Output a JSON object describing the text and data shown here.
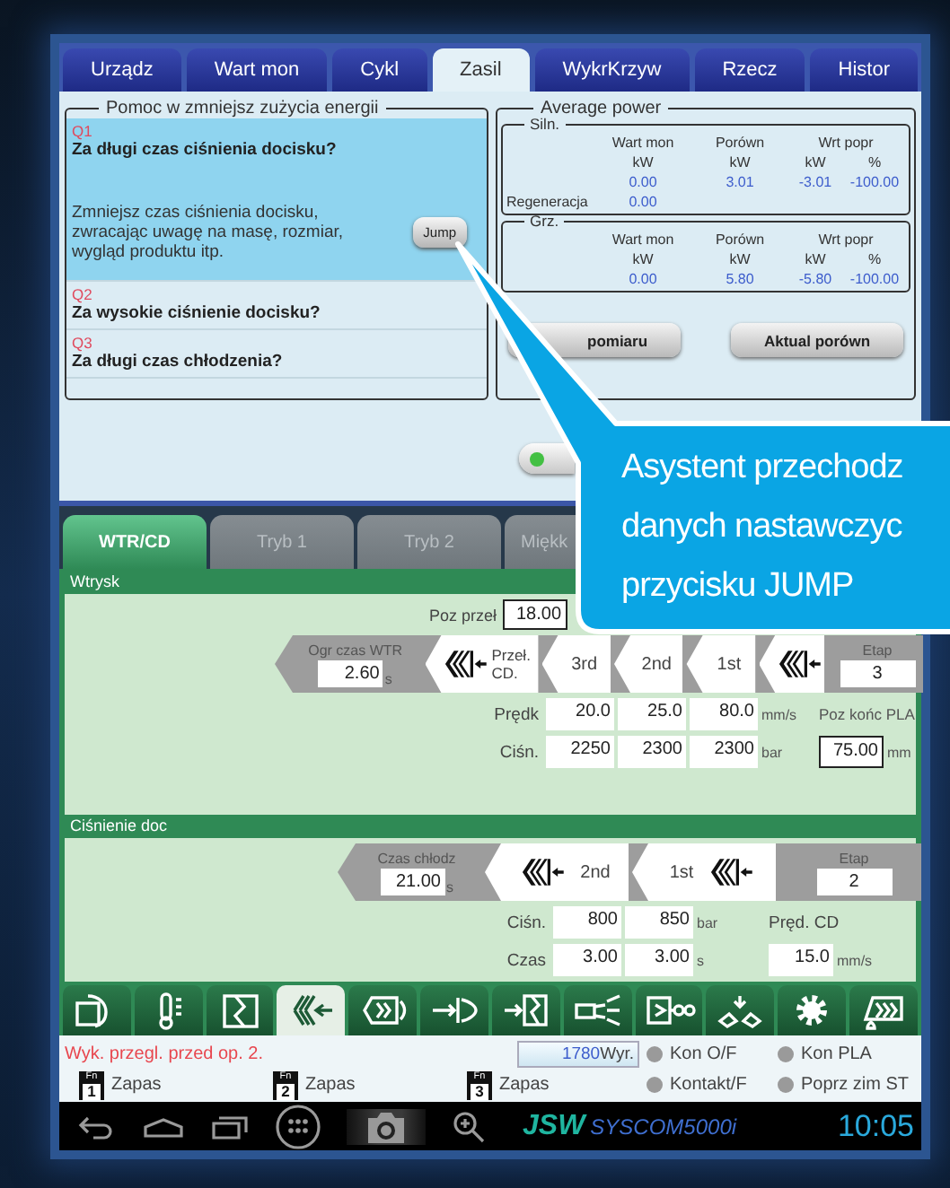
{
  "tabs": [
    {
      "label": "Urządz",
      "selected": false
    },
    {
      "label": "Wart mon",
      "selected": false
    },
    {
      "label": "Cykl",
      "selected": false
    },
    {
      "label": "Zasil",
      "selected": true
    },
    {
      "label": "WykrKrzyw",
      "selected": false
    },
    {
      "label": "Rzecz",
      "selected": false
    },
    {
      "label": "Histor",
      "selected": false
    }
  ],
  "help_panel": {
    "title": "Pomoc w zmniejsz zużycia energii",
    "items": [
      {
        "code": "Q1",
        "question": "Za długi czas ciśnienia docisku?",
        "selected": true,
        "answer": "Zmniejsz czas ciśnienia docisku, zwracając uwagę na masę, rozmiar, wygląd produktu itp.",
        "button": "Jump"
      },
      {
        "code": "Q2",
        "question": "Za wysokie ciśnienie docisku?",
        "selected": false
      },
      {
        "code": "Q3",
        "question": "Za długi czas chłodzenia?",
        "selected": false
      }
    ]
  },
  "average_power": {
    "title": "Average power",
    "groups": [
      {
        "title": "Siln.",
        "headers": [
          "Wart mon",
          "Porówn",
          "Wrt popr"
        ],
        "units": [
          "kW",
          "kW",
          "kW",
          "%"
        ],
        "values": [
          "0.00",
          "3.01",
          "-3.01",
          "-100.00"
        ],
        "rows": [
          {
            "label": "Regeneracja",
            "values": [
              "0.00"
            ]
          }
        ]
      },
      {
        "title": "Grz.",
        "headers": [
          "Wart mon",
          "Porówn",
          "Wrt popr"
        ],
        "units": [
          "kW",
          "kW",
          "kW",
          "%"
        ],
        "values": [
          "0.00",
          "5.80",
          "-5.80",
          "-100.00"
        ]
      }
    ],
    "buttons": [
      "pomiaru",
      "Aktual porówn"
    ]
  },
  "mode_indicator": {
    "on": true
  },
  "mode_tabs": [
    {
      "label": "WTR/CD",
      "selected": true
    },
    {
      "label": "Tryb 1",
      "selected": false
    },
    {
      "label": "Tryb 2",
      "selected": false
    },
    {
      "label": "Miękk",
      "selected": false
    }
  ],
  "injection": {
    "title": "Wtrysk",
    "switch_position": {
      "label": "Poz przeł",
      "value": "18.00"
    },
    "limit": {
      "label": "Ogr czas WTR",
      "value": "2.60",
      "unit": "s"
    },
    "changeover": "Przeł. CD.",
    "stages": [
      "3rd",
      "2nd",
      "1st"
    ],
    "stage_count": {
      "label": "Etap",
      "value": "3"
    },
    "rows": [
      {
        "label": "Prędk",
        "values": [
          "20.0",
          "25.0",
          "80.0"
        ],
        "unit": "mm/s"
      },
      {
        "label": "Ciśn.",
        "values": [
          "2250",
          "2300",
          "2300"
        ],
        "unit": "bar"
      }
    ],
    "end_position": {
      "label": "Poz końc PLA",
      "value": "75.00",
      "unit": "mm"
    }
  },
  "hold_pressure": {
    "title": "Ciśnienie doc",
    "cooling": {
      "label": "Czas chłodz",
      "value": "21.00",
      "unit": "s"
    },
    "stages": [
      "2nd",
      "1st"
    ],
    "stage_count": {
      "label": "Etap",
      "value": "2"
    },
    "rows": [
      {
        "label": "Ciśn.",
        "values": [
          "800",
          "850"
        ],
        "unit": "bar"
      },
      {
        "label": "Czas",
        "values": [
          "3.00",
          "3.00"
        ],
        "unit": "s"
      }
    ],
    "cd_speed": {
      "label": "Pręd. CD",
      "value": "15.0",
      "unit": "mm/s"
    }
  },
  "toolbar": [
    {
      "kind": "mold-curve",
      "selected": false
    },
    {
      "kind": "thermometer",
      "selected": false
    },
    {
      "kind": "mold",
      "selected": false
    },
    {
      "kind": "injection",
      "selected": true
    },
    {
      "kind": "plasticize",
      "selected": false
    },
    {
      "kind": "ejector",
      "selected": false
    },
    {
      "kind": "mold-close",
      "selected": false
    },
    {
      "kind": "nozzle",
      "selected": false
    },
    {
      "kind": "conveyor",
      "selected": false
    },
    {
      "kind": "fan",
      "selected": false
    },
    {
      "kind": "settings",
      "selected": false
    },
    {
      "kind": "screw-drop",
      "selected": false
    }
  ],
  "status": {
    "alarm": "Wyk. przegl. przed op. 2.",
    "counter": {
      "value": "1780",
      "unit": "Wyr."
    },
    "spares": [
      {
        "key": "Fn",
        "number": "1",
        "label": "Zapas"
      },
      {
        "key": "Fn",
        "number": "2",
        "label": "Zapas"
      },
      {
        "key": "Fn",
        "number": "3",
        "label": "Zapas"
      }
    ],
    "lamps": [
      {
        "label": "Kon O/F",
        "on": false
      },
      {
        "label": "Kon PLA",
        "on": false
      },
      {
        "label": "Kontakt/F",
        "on": false
      },
      {
        "label": "Poprz zim ST",
        "on": false
      }
    ]
  },
  "nav_bar": {
    "brand": "JSW",
    "product": "SYSCOM5000i",
    "time": "10:05"
  },
  "callout": {
    "lines": [
      "Asystent przechodz",
      "danych nastawczyc",
      "przycisku JUMP"
    ]
  }
}
